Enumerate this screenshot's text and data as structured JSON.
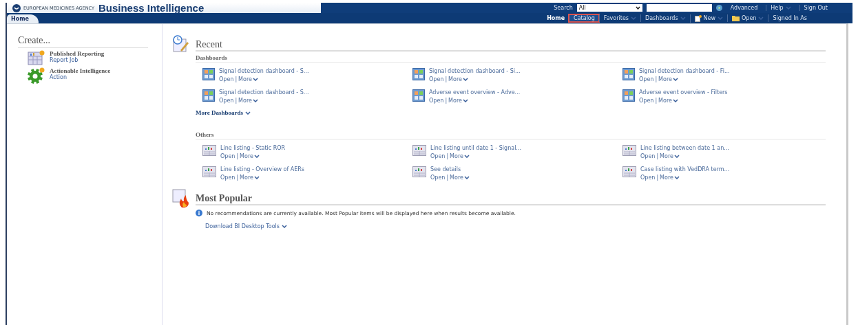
{
  "header": {
    "logo_text": "EUROPEAN MEDICINES AGENCY",
    "title": "Business Intelligence",
    "search": {
      "label": "Search",
      "scope": "All"
    },
    "links": [
      {
        "label": "Advanced",
        "dropdown": false
      },
      {
        "label": "Help",
        "dropdown": true
      },
      {
        "label": "Sign Out",
        "dropdown": false
      }
    ]
  },
  "nav": {
    "tabs": [
      {
        "label": "Home",
        "selected": true
      }
    ],
    "links": [
      {
        "label": "Home",
        "kind": "plain",
        "selected": true,
        "highlighted": false
      },
      {
        "label": "Catalog",
        "kind": "plain",
        "selected": false,
        "highlighted": true
      },
      {
        "label": "Favorites",
        "kind": "dropdown",
        "selected": false,
        "highlighted": false
      },
      {
        "label": "Dashboards",
        "kind": "dropdown",
        "selected": false,
        "highlighted": false
      },
      {
        "label": "New",
        "kind": "new",
        "selected": false,
        "highlighted": false
      },
      {
        "label": "Open",
        "kind": "open",
        "selected": false,
        "highlighted": false
      },
      {
        "label": "Signed In As",
        "kind": "plain",
        "selected": false,
        "highlighted": false
      }
    ]
  },
  "create": {
    "title": "Create...",
    "items": [
      {
        "kind": "report",
        "title": "Published Reporting",
        "subtitle": "Report Job"
      },
      {
        "kind": "gear",
        "title": "Actionable Intelligence",
        "subtitle": "Action"
      }
    ]
  },
  "recent": {
    "title": "Recent",
    "separator": "|",
    "groups": [
      {
        "title": "Dashboards",
        "kind": "dashboard",
        "more": "More Dashboards",
        "items": [
          {
            "title": "Signal detection dashboard - S...",
            "open": "Open",
            "more": "More"
          },
          {
            "title": "Signal detection dashboard - Si...",
            "open": "Open",
            "more": "More"
          },
          {
            "title": "Signal detection dashboard - Fi...",
            "open": "Open",
            "more": "More"
          },
          {
            "title": "Signal detection dashboard - S...",
            "open": "Open",
            "more": "More"
          },
          {
            "title": "Adverse event overview - Adve...",
            "open": "Open",
            "more": "More"
          },
          {
            "title": "Adverse event overview - Filters",
            "open": "Open",
            "more": "More"
          }
        ]
      },
      {
        "title": "Others",
        "kind": "analysis",
        "items": [
          {
            "title": "Line listing - Static ROR",
            "open": "Open",
            "more": "More"
          },
          {
            "title": "Line listing until date 1 - Signal...",
            "open": "Open",
            "more": "More"
          },
          {
            "title": "Line listing between date 1 an...",
            "open": "Open",
            "more": "More"
          },
          {
            "title": "Line listing - Overview of AERs",
            "open": "Open",
            "more": "More"
          },
          {
            "title": "See details",
            "open": "Open",
            "more": "More"
          },
          {
            "title": "Case listing with VedDRA term...",
            "open": "Open",
            "more": "More"
          }
        ]
      }
    ]
  },
  "popular": {
    "title": "Most Popular",
    "message": "No recommendations are currently available. Most Popular items will be displayed here when results become available.",
    "link": "Download BI Desktop Tools"
  }
}
